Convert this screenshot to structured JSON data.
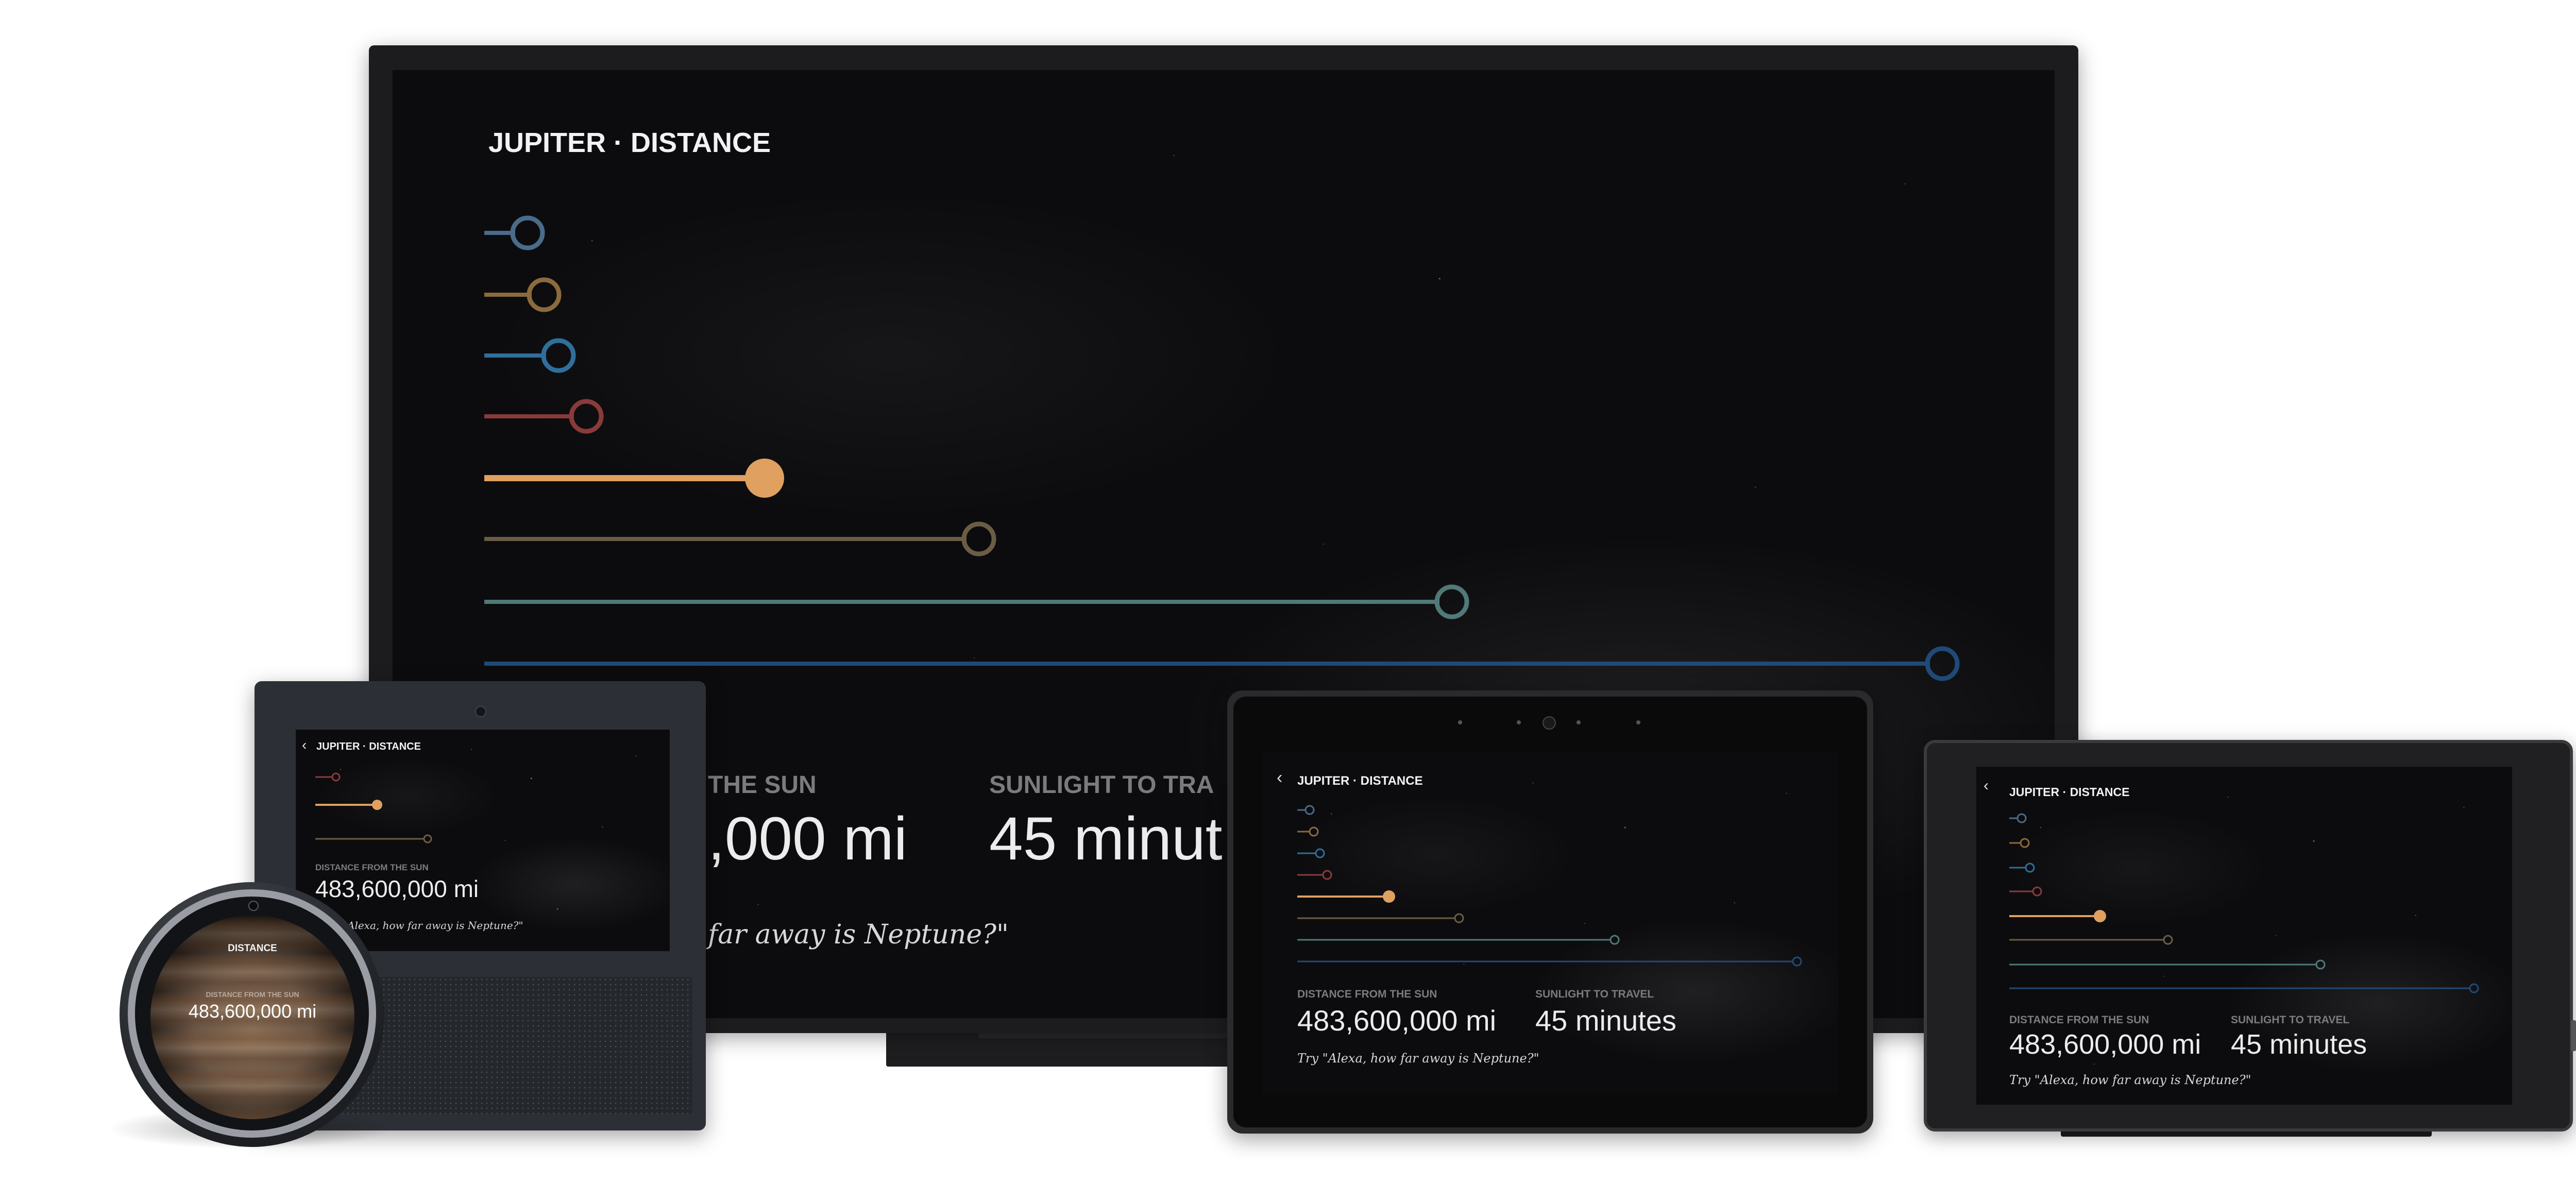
{
  "screen": {
    "title": "JUPITER · DISTANCE",
    "back_icon": "chevron-left-icon",
    "orbit_colors": [
      "#4a6b8a",
      "#8b6a3c",
      "#2f6f9c",
      "#8a3a3a",
      "#e0a060",
      "#6b5d45",
      "#4f7a78",
      "#1f4a78"
    ],
    "selected_color": "#e0a060",
    "stats": [
      {
        "label": "DISTANCE FROM THE SUN",
        "value": "483,600,000 mi"
      },
      {
        "label": "SUNLIGHT TO TRAVEL",
        "value": "45 minutes"
      }
    ],
    "hint": "Try \"Alexa, how far away is Neptune?\""
  },
  "tv_partial": {
    "label_1": "THE SUN",
    "value_1": ",000 mi",
    "label_2": "SUNLIGHT TO TRA",
    "value_2": "45 minut",
    "hint": "far away is Neptune?\""
  },
  "echo_show_partial": {
    "hint": "Alexa, how far away is Neptune?\""
  },
  "echo_spot": {
    "title": "DISTANCE",
    "label": "DISTANCE FROM THE SUN",
    "value": "483,600,000 mi"
  }
}
